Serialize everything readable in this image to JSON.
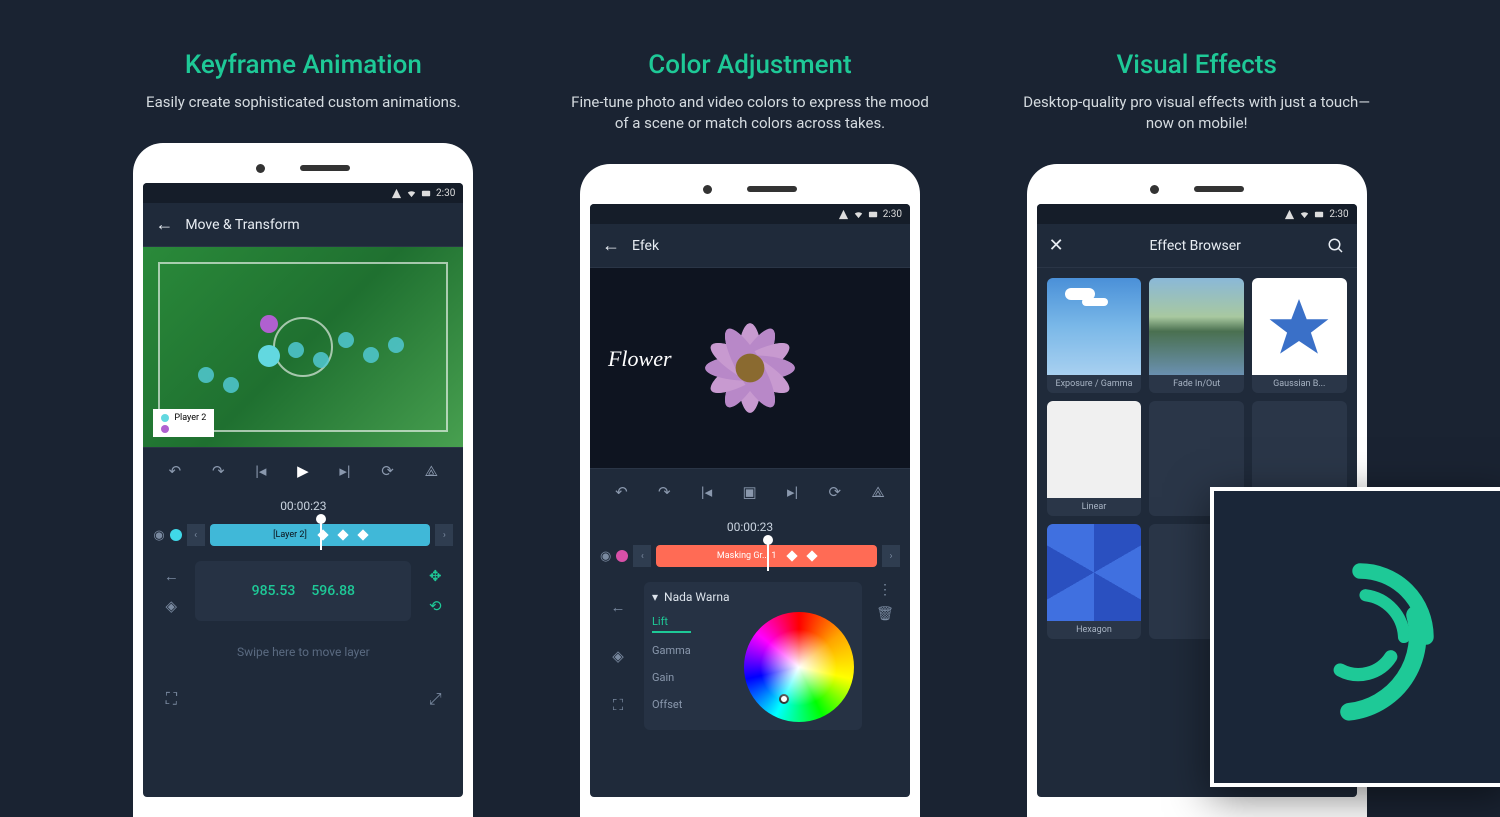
{
  "panels": [
    {
      "title": "Keyframe Animation",
      "subtitle": "Easily create sophisticated custom animations."
    },
    {
      "title": "Color Adjustment",
      "subtitle": "Fine-tune photo and video colors to express the mood of a scene or match colors across takes."
    },
    {
      "title": "Visual Effects",
      "subtitle": "Desktop-quality pro visual effects with just a touch—now on mobile!"
    }
  ],
  "status_time": "2:30",
  "screen1": {
    "header": "Move & Transform",
    "legend_player": "Player 2",
    "timecode": "00:00:23",
    "clip_label": "[Layer 2]",
    "val1": "985.53",
    "val2": "596.88",
    "swipe_hint": "Swipe here to move layer"
  },
  "screen2": {
    "header": "Efek",
    "overlay_text": "Flower",
    "timecode": "00:00:23",
    "clip_label": "Masking Gr... 1",
    "section_title": "Nada Warna",
    "tabs": [
      "Lift",
      "Gamma",
      "Gain",
      "Offset"
    ]
  },
  "screen3": {
    "header": "Effect Browser",
    "effects_row1": [
      "Exposure / Gamma",
      "Fade In/Out",
      "Gaussian B..."
    ],
    "effects_row2": [
      "Linear",
      "",
      ""
    ],
    "effects_row3": [
      "Hexagon",
      "",
      ""
    ]
  },
  "colors": {
    "accent": "#1ec997",
    "bg": "#1a2332"
  }
}
